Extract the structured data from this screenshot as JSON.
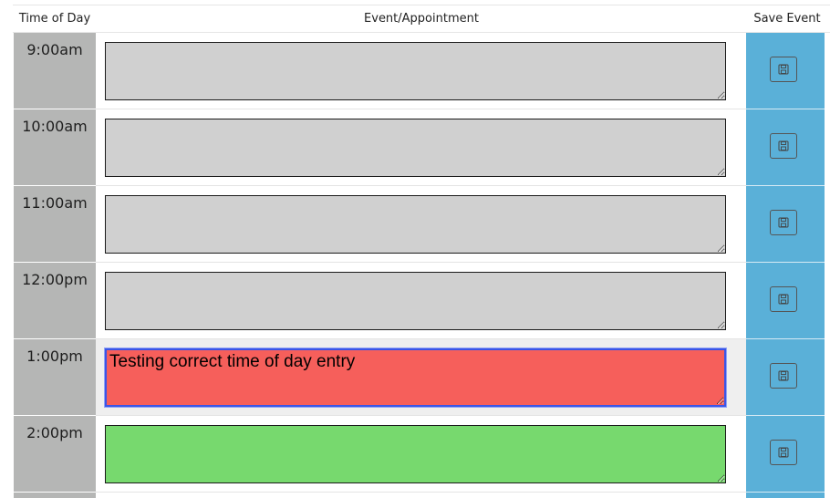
{
  "header": {
    "time_label": "Time of Day",
    "event_label": "Event/Appointment",
    "save_label": "Save Event"
  },
  "rows": [
    {
      "hour": "9:00am",
      "text": "",
      "state": "past"
    },
    {
      "hour": "10:00am",
      "text": "",
      "state": "past"
    },
    {
      "hour": "11:00am",
      "text": "",
      "state": "past"
    },
    {
      "hour": "12:00pm",
      "text": "",
      "state": "past"
    },
    {
      "hour": "1:00pm",
      "text": "Testing correct time of day entry",
      "state": "present"
    },
    {
      "hour": "2:00pm",
      "text": "",
      "state": "future"
    }
  ],
  "icons": {
    "save": "save-icon"
  },
  "colors": {
    "past": "#d0d0d0",
    "present": "#f65f5b",
    "future": "#77d96e",
    "save_column": "#5ab0d8",
    "hour_column": "#b5b6b5"
  }
}
